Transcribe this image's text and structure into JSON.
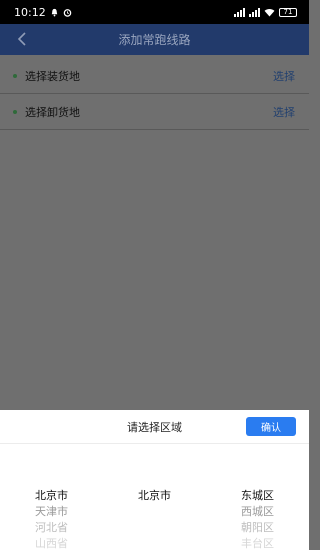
{
  "status_bar": {
    "time": "10:12",
    "battery": "71"
  },
  "header": {
    "title": "添加常跑线路"
  },
  "rows": [
    {
      "label": "选择装货地",
      "action": "选择"
    },
    {
      "label": "选择卸货地",
      "action": "选择"
    }
  ],
  "picker": {
    "title": "请选择区域",
    "confirm_label": "确认",
    "province": [
      "北京市",
      "天津市",
      "河北省",
      "山西省"
    ],
    "city": [
      "北京市"
    ],
    "district": [
      "东城区",
      "西城区",
      "朝阳区",
      "丰台区"
    ]
  }
}
